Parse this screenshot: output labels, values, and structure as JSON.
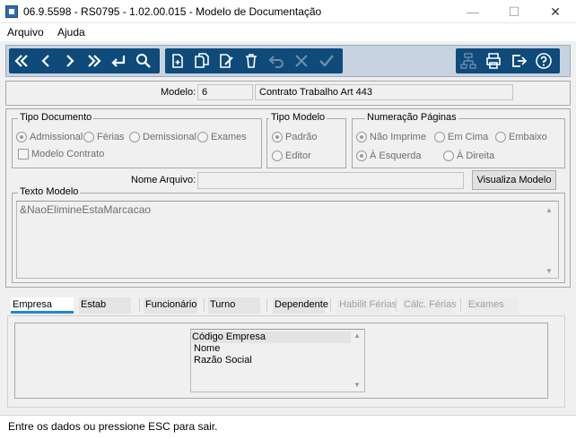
{
  "window": {
    "title": "06.9.5598 - RS0795 - 1.02.00.015 - Modelo de Documentação"
  },
  "menu": {
    "items": [
      "Arquivo",
      "Ajuda"
    ]
  },
  "toolbar": {
    "nav": [
      "first-icon",
      "previous-icon",
      "next-icon",
      "last-icon",
      "goto-icon",
      "search-icon"
    ],
    "edit": [
      "new-icon",
      "copy-icon",
      "edit-icon",
      "delete-icon",
      "undo-icon",
      "cancel-icon",
      "confirm-icon"
    ],
    "right": [
      "tree-icon",
      "print-icon",
      "exit-icon",
      "help-icon"
    ]
  },
  "header": {
    "modelo_label": "Modelo:",
    "modelo_code": "6",
    "modelo_desc": "Contrato Trabalho Art 443"
  },
  "tipo_documento": {
    "legend": "Tipo Documento",
    "options": [
      "Admissional",
      "Férias",
      "Demissional",
      "Exames"
    ],
    "selected": "Admissional",
    "checkbox_label": "Modelo Contrato"
  },
  "tipo_modelo": {
    "legend": "Tipo Modelo",
    "options": [
      "Padrão",
      "Editor"
    ],
    "selected": "Padrão"
  },
  "numeracao": {
    "legend": "Numeração Páginas",
    "options": [
      "Não Imprime",
      "Em Cima",
      "Embaixo",
      "À Esquerda",
      "À Direita"
    ],
    "selected_1": "Não Imprime",
    "selected_2": "À Esquerda"
  },
  "arquivo": {
    "label": "Nome Arquivo:",
    "value": "",
    "button": "Visualiza Modelo"
  },
  "texto_modelo": {
    "legend": "Texto Modelo",
    "value": "&NaoElimineEstaMarcacao"
  },
  "tabs": [
    "Empresa",
    "Estab",
    "Funcionário",
    "Turno",
    "Dependente",
    "Habilit Férias",
    "Cálc. Férias",
    "Exames"
  ],
  "active_tab": "Empresa",
  "fields_list": [
    "Código Empresa",
    "Nome",
    "Razão Social"
  ],
  "status": {
    "text": "Entre os dados ou pressione ESC para sair."
  },
  "colors": {
    "toolbar_bg": "#0e4a7a",
    "tab_accent": "#1e88d8"
  }
}
